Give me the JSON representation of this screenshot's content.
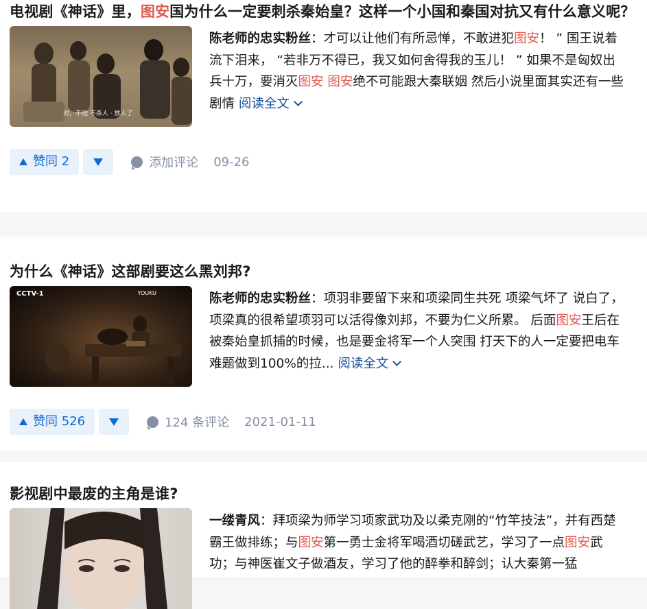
{
  "items": [
    {
      "title_segments": [
        {
          "text": "电视剧《神话》里，",
          "hl": false
        },
        {
          "text": "图安",
          "hl": true
        },
        {
          "text": "国为什么一定要刺杀秦始皇？这样一个小国和秦国对抗又有什么意义呢？",
          "hl": false
        }
      ],
      "author": "陈老师的忠实粉丝",
      "excerpt_segments": [
        {
          "text": "：才可以让他们有所忌惮，不敢进犯",
          "hl": false
        },
        {
          "text": "图安",
          "hl": true
        },
        {
          "text": "！ ” 国王说着流下泪来， “若非万不得已，我又如何舍得我的玉儿！ ” 如果不是匈奴出兵十万，要消灭",
          "hl": false
        },
        {
          "text": "图安",
          "hl": true
        },
        {
          "text": " ",
          "hl": false
        },
        {
          "text": "图安",
          "hl": true
        },
        {
          "text": "绝不可能跟大秦联姻 然后小说里面其实还有一些剧情 ",
          "hl": false
        }
      ],
      "read_more": "阅读全文",
      "vote_label": "赞同 2",
      "comment_label": "添加评论",
      "date": "09-26",
      "thumb_caption": "对，不他 不杀人 · 放人了"
    },
    {
      "title_segments": [
        {
          "text": "为什么《神话》这部剧要这么黑刘邦?",
          "hl": false
        }
      ],
      "author": "陈老师的忠实粉丝",
      "excerpt_segments": [
        {
          "text": "：项羽非要留下来和项梁同生共死 项梁气坏了 说白了，项梁真的很希望项羽可以活得像刘邦，不要为仁义所累。 后面",
          "hl": false
        },
        {
          "text": "图安",
          "hl": true
        },
        {
          "text": "王后在被秦始皇抓捕的时候，也是要金将军一个人突围 打天下的人一定要把电车难题做到100%的拉... ",
          "hl": false
        }
      ],
      "read_more": "阅读全文",
      "vote_label": "赞同 526",
      "comment_label": "124 条评论",
      "date": "2021-01-11",
      "thumb_logo_left": "CCTV-1",
      "thumb_logo_right": "YOUKU"
    },
    {
      "title_segments": [
        {
          "text": "影视剧中最废的主角是谁?",
          "hl": false
        }
      ],
      "author": "一缕青风",
      "excerpt_segments": [
        {
          "text": "：拜项梁为师学习项家武功及以柔克刚的“竹竿技法”，并有西楚霸王做排练；与",
          "hl": false
        },
        {
          "text": "图安",
          "hl": true
        },
        {
          "text": "第一勇士金将军喝酒切磋武艺，学习了一点",
          "hl": false
        },
        {
          "text": "图安",
          "hl": true
        },
        {
          "text": "武功；与神医崔文子做酒友，学习了他的醉拳和醉剑；认大秦第一猛",
          "hl": false
        }
      ]
    }
  ],
  "colors": {
    "highlight": "#e05a4d",
    "link": "#175199",
    "vote": "#0c6bd6",
    "vote_bg": "#e9f1fb",
    "meta": "#8590a6",
    "divider": "#f6f6f6"
  },
  "icons": {
    "vote_up": "triangle-up-icon",
    "vote_down": "triangle-down-icon",
    "comment": "comment-bubble-icon",
    "read_more": "chevron-down-icon"
  }
}
